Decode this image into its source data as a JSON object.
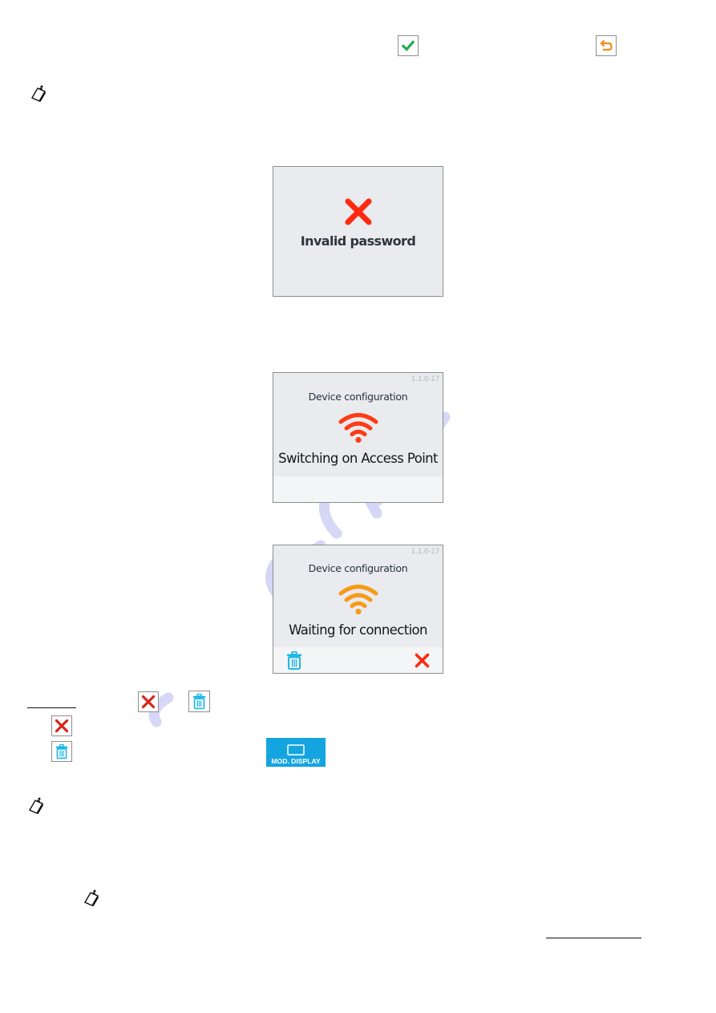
{
  "document": {
    "type": "manual-page"
  },
  "icons_top": {
    "confirm": "check-icon",
    "back": "undo-arrow-icon"
  },
  "note_icon": "note-clipboard-icon",
  "screens": [
    {
      "id": "invalid-password",
      "status_icon": "error-x-icon",
      "message": "Invalid password"
    },
    {
      "id": "switching-on-ap",
      "version": "1.1.0-17",
      "title": "Device configuration",
      "status_icon": "wifi-icon",
      "status_color": "#ff3b14",
      "message": "Switching on Access Point"
    },
    {
      "id": "waiting-for-connection",
      "version": "1.1.0-17",
      "title": "Device configuration",
      "status_icon": "wifi-icon",
      "status_color": "#f79a1a",
      "message": "Waiting for connection",
      "buttons": [
        {
          "icon": "trash-icon",
          "color": "#1eb8e6"
        },
        {
          "icon": "close-x-icon",
          "color": "#ff2a0f"
        }
      ]
    }
  ],
  "legend_icons": {
    "close": "close-x-icon",
    "delete": "trash-icon"
  },
  "mod_display_button": {
    "label": "MOD. DISPLAY",
    "icon": "display-icon",
    "color": "#14a5e0"
  },
  "colors": {
    "check_green": "#1fae4b",
    "undo_orange": "#f08c16",
    "error_red": "#ff2a0f",
    "wifi_red": "#ff3b14",
    "wifi_orange": "#f79a1a",
    "trash_cyan": "#1eb8e6",
    "screen_bg": "#e9ebef",
    "watermark": "#c9c9f5"
  }
}
